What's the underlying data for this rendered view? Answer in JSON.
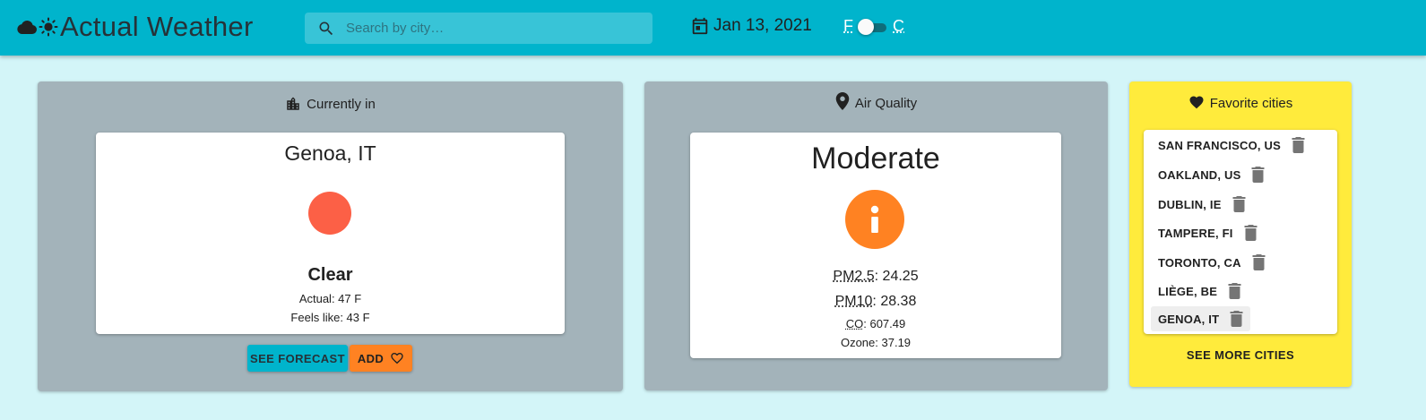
{
  "header": {
    "app_title": "Actual Weather",
    "logo_icons": [
      "cloud-icon",
      "sun-icon"
    ],
    "search": {
      "placeholder": "Search by city…",
      "value": "",
      "icon": "search-icon"
    },
    "date": {
      "icon": "calendar-icon",
      "text": "Jan 13, 2021"
    },
    "unit_toggle": {
      "left_label": "F",
      "right_label": "C",
      "selected": "F"
    },
    "background_color": "#00b4cc"
  },
  "current": {
    "heading": "Currently in",
    "heading_icon": "building-icon",
    "city": "Genoa, IT",
    "weather_icon": "clear-sun-icon",
    "weather_icon_color": "#fc6046",
    "condition": "Clear",
    "actual": "Actual: 47 F",
    "feels_like": "Feels like: 43 F",
    "forecast_button": "SEE FORECAST",
    "add_button": "ADD",
    "add_icon": "heart-outline-icon"
  },
  "air_quality": {
    "heading": "Air Quality",
    "heading_icon": "location-pin-icon",
    "status": "Moderate",
    "status_icon": "info-icon",
    "status_color": "#ff8222",
    "pm25": {
      "label": "PM2.5",
      "value": ": 24.25"
    },
    "pm10": {
      "label": "PM10",
      "value": ": 28.38"
    },
    "co": {
      "label": "CO",
      "value": ": 607.49"
    },
    "ozone": "Ozone: 37.19"
  },
  "favorites": {
    "heading": "Favorite cities",
    "heading_icon": "heart-icon",
    "items": [
      {
        "name": "SAN FRANCISCO, US"
      },
      {
        "name": "OAKLAND, US"
      },
      {
        "name": "DUBLIN, IE"
      },
      {
        "name": "TAMPERE, FI"
      },
      {
        "name": "TORONTO, CA"
      },
      {
        "name": "LIÈGE, BE"
      },
      {
        "name": "GENOA, IT"
      }
    ],
    "selected": "GENOA, IT",
    "delete_icon": "trash-icon",
    "see_more": "SEE MORE CITIES",
    "background_color": "#ffeb3c"
  }
}
